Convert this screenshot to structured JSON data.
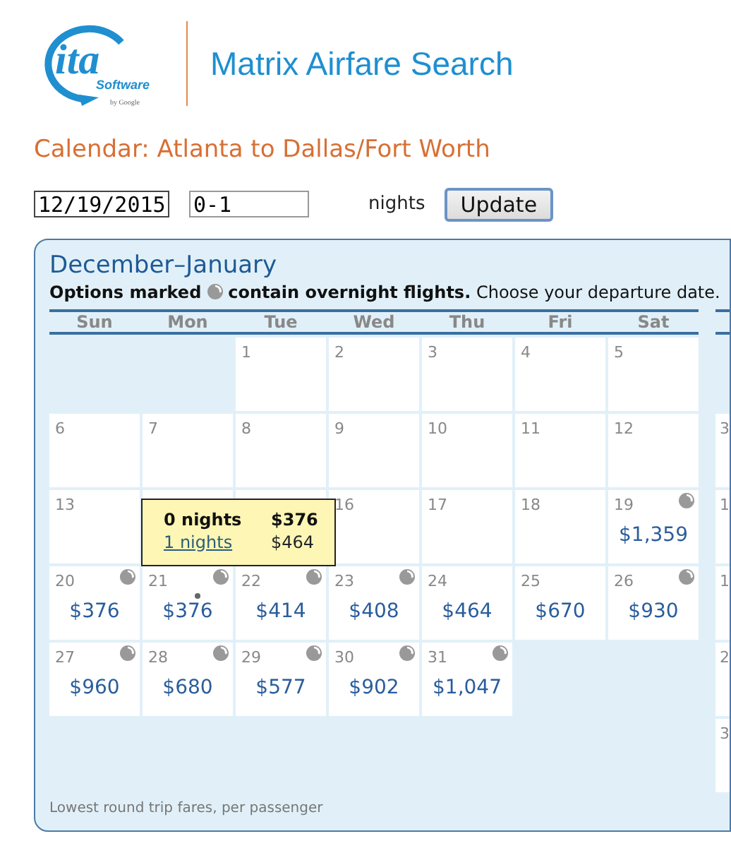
{
  "header": {
    "logo": {
      "mark": "ita",
      "tagline": "Software",
      "byline": "by Google"
    },
    "title": "Matrix Airfare Search"
  },
  "heading": "Calendar: Atlanta to Dallas/Fort Worth",
  "form": {
    "date": "12/19/2015",
    "nights": "0-1",
    "nights_label": "nights",
    "button": "Update"
  },
  "calendar": {
    "title": "December–January",
    "legend_start": "Options marked",
    "legend_end": "**contain overnight flights.** Choose your departure date.",
    "weekdays": [
      "Sun",
      "Mon",
      "Tue",
      "Wed",
      "Thu",
      "Fri",
      "Sat"
    ],
    "weeks": [
      [
        {
          "kind": "blank"
        },
        {
          "kind": "blank"
        },
        {
          "day": "1"
        },
        {
          "day": "2"
        },
        {
          "day": "3"
        },
        {
          "day": "4"
        },
        {
          "day": "5"
        }
      ],
      [
        {
          "day": "6"
        },
        {
          "day": "7"
        },
        {
          "day": "8"
        },
        {
          "day": "9"
        },
        {
          "day": "10"
        },
        {
          "day": "11"
        },
        {
          "day": "12"
        }
      ],
      [
        {
          "day": "13"
        },
        {
          "kind": "covered"
        },
        {
          "kind": "covered"
        },
        {
          "day": "16"
        },
        {
          "day": "17"
        },
        {
          "day": "18"
        },
        {
          "day": "19",
          "price": "$1,359",
          "overnight": true
        }
      ],
      [
        {
          "day": "20",
          "price": "$376",
          "overnight": true
        },
        {
          "day": "21",
          "price": "$376",
          "overnight": true,
          "hovered": true
        },
        {
          "day": "22",
          "price": "$414",
          "overnight": true
        },
        {
          "day": "23",
          "price": "$408",
          "overnight": true
        },
        {
          "day": "24",
          "price": "$464",
          "overnight": false
        },
        {
          "day": "25",
          "price": "$670",
          "overnight": false
        },
        {
          "day": "26",
          "price": "$930",
          "overnight": true
        }
      ],
      [
        {
          "day": "27",
          "price": "$960",
          "overnight": true
        },
        {
          "day": "28",
          "price": "$680",
          "overnight": true
        },
        {
          "day": "29",
          "price": "$577",
          "overnight": true
        },
        {
          "day": "30",
          "price": "$902",
          "overnight": true
        },
        {
          "day": "31",
          "price": "$1,047",
          "overnight": true
        },
        {
          "kind": "blank"
        },
        {
          "kind": "blank"
        }
      ]
    ],
    "tooltip": {
      "rows": [
        {
          "label": "0 nights",
          "price": "$376",
          "selected": true
        },
        {
          "label": "1 nights",
          "price": "$464",
          "selected": false
        }
      ]
    },
    "next_month": {
      "weeks": [
        {
          "kind": "blank"
        },
        {
          "day": "3"
        },
        {
          "day": "1"
        },
        {
          "day": "1"
        },
        {
          "day": "2"
        },
        {
          "day": "3"
        }
      ]
    },
    "footer": "Lowest round trip fares, per passenger"
  }
}
